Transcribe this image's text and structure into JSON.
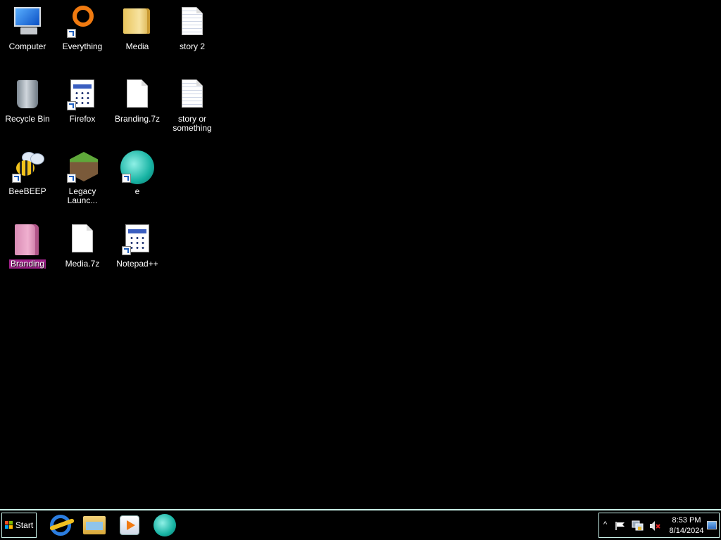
{
  "desktop": {
    "icons": [
      {
        "label": "Computer",
        "type": "computer",
        "shortcut": false
      },
      {
        "label": "Everything",
        "type": "everything",
        "shortcut": true
      },
      {
        "label": "Media",
        "type": "folder",
        "shortcut": false
      },
      {
        "label": "story 2",
        "type": "text-document",
        "shortcut": false
      },
      {
        "label": "Recycle Bin",
        "type": "recycle-bin",
        "shortcut": false
      },
      {
        "label": "Firefox",
        "type": "application",
        "shortcut": true
      },
      {
        "label": "Branding.7z",
        "type": "document",
        "shortcut": false
      },
      {
        "label": "story or something",
        "type": "text-document",
        "shortcut": false
      },
      {
        "label": "BeeBEEP",
        "type": "beebeep",
        "shortcut": true
      },
      {
        "label": "Legacy Launc...",
        "type": "minecraft",
        "shortcut": true
      },
      {
        "label": "e",
        "type": "teal-app",
        "shortcut": true
      },
      {
        "label": "Branding",
        "type": "folder-pink",
        "shortcut": false,
        "selected": true
      },
      {
        "label": "Media.7z",
        "type": "document",
        "shortcut": false
      },
      {
        "label": "Notepad++",
        "type": "application",
        "shortcut": true
      }
    ],
    "selection_color": "#a0208a"
  },
  "taskbar": {
    "start_label": "Start",
    "pinned": [
      "internet-explorer-icon",
      "file-explorer-icon",
      "media-player-icon",
      "teal-app-icon"
    ],
    "tray": {
      "chevron": "^",
      "time": "8:53 PM",
      "date": "8/14/2024"
    },
    "accent": "#c9f0e8"
  }
}
